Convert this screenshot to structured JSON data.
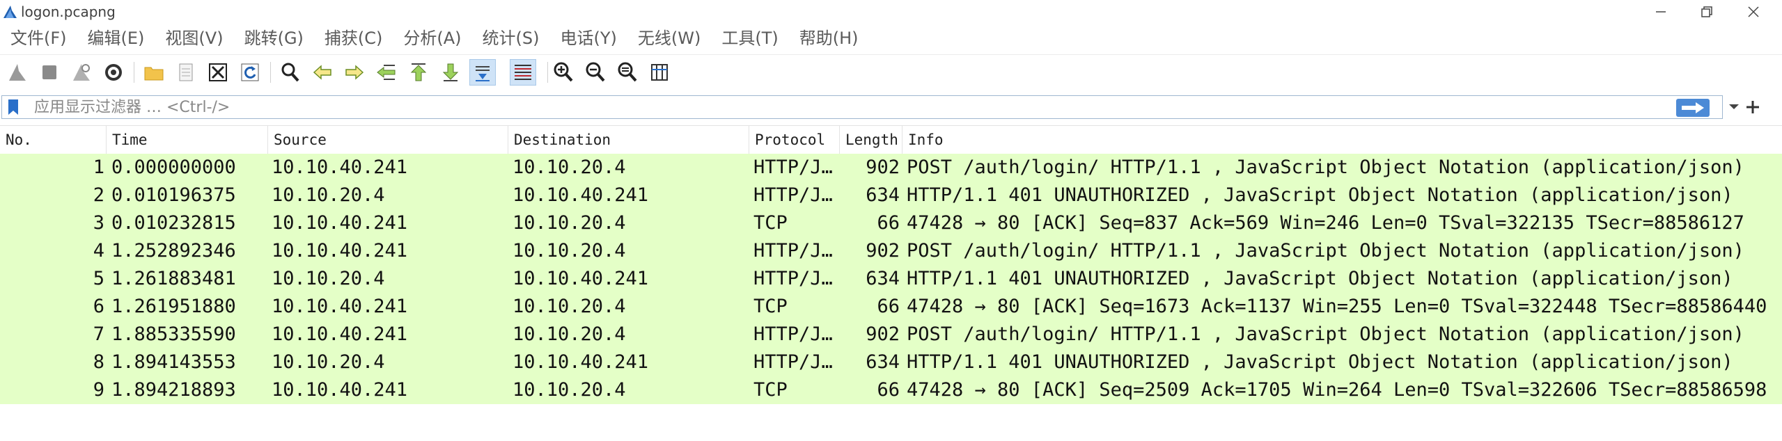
{
  "window": {
    "title": "logon.pcapng",
    "controls": [
      "minimize-icon",
      "restore-icon",
      "close-icon"
    ]
  },
  "menu": [
    "文件(F)",
    "编辑(E)",
    "视图(V)",
    "跳转(G)",
    "捕获(C)",
    "分析(A)",
    "统计(S)",
    "电话(Y)",
    "无线(W)",
    "工具(T)",
    "帮助(H)"
  ],
  "toolbar": {
    "icons": [
      "start-capture-icon",
      "stop-capture-icon",
      "restart-capture-icon",
      "capture-options-icon",
      "open-file-icon",
      "save-file-icon",
      "close-file-icon",
      "reload-icon",
      "find-packet-icon",
      "go-back-icon",
      "go-forward-icon",
      "go-to-packet-icon",
      "first-packet-icon",
      "last-packet-icon",
      "autoscroll-icon",
      "colorize-icon",
      "zoom-in-icon",
      "zoom-out-icon",
      "normal-size-icon",
      "resize-columns-icon"
    ]
  },
  "filter": {
    "placeholder": "应用显示过滤器 … <Ctrl-/>",
    "value": ""
  },
  "columns": {
    "no": "No.",
    "time": "Time",
    "source": "Source",
    "destination": "Destination",
    "protocol": "Protocol",
    "length": "Length",
    "info": "Info"
  },
  "packets": [
    {
      "no": "1",
      "time": "0.000000000",
      "source": "10.10.40.241",
      "destination": "10.10.20.4",
      "protocol": "HTTP/J…",
      "length": "902",
      "info": "POST /auth/login/ HTTP/1.1 , JavaScript Object Notation (application/json)"
    },
    {
      "no": "2",
      "time": "0.010196375",
      "source": "10.10.20.4",
      "destination": "10.10.40.241",
      "protocol": "HTTP/J…",
      "length": "634",
      "info": "HTTP/1.1 401 UNAUTHORIZED , JavaScript Object Notation (application/json)"
    },
    {
      "no": "3",
      "time": "0.010232815",
      "source": "10.10.40.241",
      "destination": "10.10.20.4",
      "protocol": "TCP",
      "length": "66",
      "info": "47428 → 80 [ACK] Seq=837 Ack=569 Win=246 Len=0 TSval=322135 TSecr=88586127"
    },
    {
      "no": "4",
      "time": "1.252892346",
      "source": "10.10.40.241",
      "destination": "10.10.20.4",
      "protocol": "HTTP/J…",
      "length": "902",
      "info": "POST /auth/login/ HTTP/1.1 , JavaScript Object Notation (application/json)"
    },
    {
      "no": "5",
      "time": "1.261883481",
      "source": "10.10.20.4",
      "destination": "10.10.40.241",
      "protocol": "HTTP/J…",
      "length": "634",
      "info": "HTTP/1.1 401 UNAUTHORIZED , JavaScript Object Notation (application/json)"
    },
    {
      "no": "6",
      "time": "1.261951880",
      "source": "10.10.40.241",
      "destination": "10.10.20.4",
      "protocol": "TCP",
      "length": "66",
      "info": "47428 → 80 [ACK] Seq=1673 Ack=1137 Win=255 Len=0 TSval=322448 TSecr=88586440"
    },
    {
      "no": "7",
      "time": "1.885335590",
      "source": "10.10.40.241",
      "destination": "10.10.20.4",
      "protocol": "HTTP/J…",
      "length": "902",
      "info": "POST /auth/login/ HTTP/1.1 , JavaScript Object Notation (application/json)"
    },
    {
      "no": "8",
      "time": "1.894143553",
      "source": "10.10.20.4",
      "destination": "10.10.40.241",
      "protocol": "HTTP/J…",
      "length": "634",
      "info": "HTTP/1.1 401 UNAUTHORIZED , JavaScript Object Notation (application/json)"
    },
    {
      "no": "9",
      "time": "1.894218893",
      "source": "10.10.40.241",
      "destination": "10.10.20.4",
      "protocol": "TCP",
      "length": "66",
      "info": "47428 → 80 [ACK] Seq=2509 Ack=1705 Win=264 Len=0 TSval=322606 TSecr=88586598"
    }
  ],
  "colors": {
    "row_background": "#e4ffc7",
    "apply_button": "#4c8ad6",
    "active_toolbar": "#cfe3f7"
  }
}
